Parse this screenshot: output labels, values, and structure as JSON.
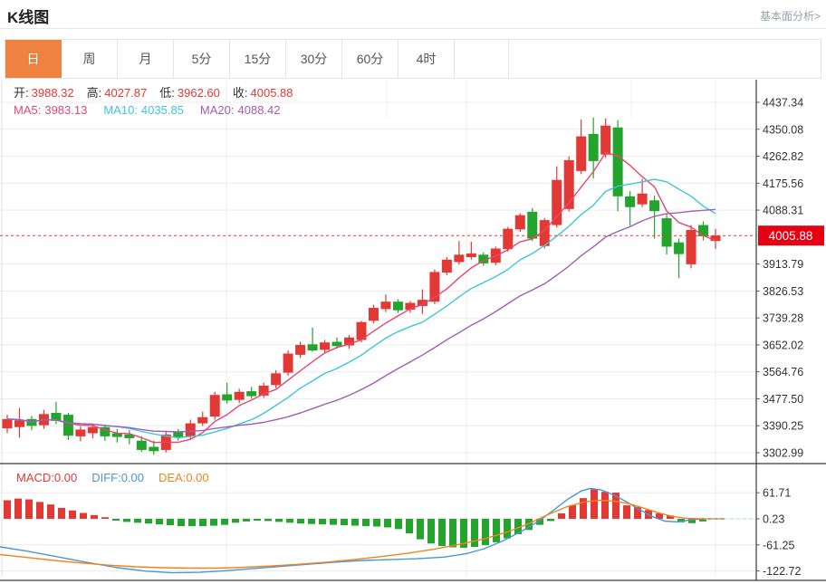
{
  "header": {
    "title": "K线图",
    "link": "基本面分析>"
  },
  "tabs": [
    {
      "label": "日",
      "active": true
    },
    {
      "label": "周",
      "active": false
    },
    {
      "label": "月",
      "active": false
    },
    {
      "label": "5分",
      "active": false
    },
    {
      "label": "15分",
      "active": false
    },
    {
      "label": "30分",
      "active": false
    },
    {
      "label": "60分",
      "active": false
    },
    {
      "label": "4时",
      "active": false
    }
  ],
  "info": {
    "open_label": "开:",
    "open": "3988.32",
    "high_label": "高:",
    "high": "4027.87",
    "low_label": "低:",
    "low": "3962.60",
    "close_label": "收:",
    "close": "4005.88",
    "ma5_label": "MA5:",
    "ma5": "3983.13",
    "ma10_label": "MA10:",
    "ma10": "4035.85",
    "ma20_label": "MA20:",
    "ma20": "4088.42"
  },
  "colors": {
    "up": "#e23934",
    "down": "#22a42d",
    "ma5": "#e8456f",
    "ma10": "#3ec6db",
    "ma20": "#a35cb5",
    "diff": "#4a97d2",
    "dea": "#f5821f",
    "tab_accent": "#ef8240",
    "price_box": "#e60012",
    "label": "#333333",
    "grid": "#ececec",
    "axis": "#3a3a3a"
  },
  "chart_data": {
    "type": "candlestick",
    "title": "K线图",
    "y_ticks": [
      "4437.34",
      "4350.08",
      "4262.82",
      "4175.56",
      "4088.31",
      "3913.79",
      "3826.53",
      "3739.28",
      "3652.02",
      "3564.76",
      "3477.50",
      "3390.25",
      "3302.99"
    ],
    "y_top_value": 4437.34,
    "y_bottom_value": 3302.99,
    "price_line": {
      "value": 4005.88,
      "label": "4005.88"
    },
    "ma_periods": [
      5,
      10,
      20
    ],
    "candles": [
      [
        3382,
        3426,
        3366,
        3412
      ],
      [
        3386,
        3448,
        3352,
        3408
      ],
      [
        3412,
        3422,
        3376,
        3390
      ],
      [
        3392,
        3442,
        3380,
        3428
      ],
      [
        3432,
        3468,
        3396,
        3406
      ],
      [
        3426,
        3432,
        3344,
        3358
      ],
      [
        3356,
        3388,
        3340,
        3378
      ],
      [
        3366,
        3396,
        3350,
        3386
      ],
      [
        3386,
        3394,
        3342,
        3356
      ],
      [
        3366,
        3380,
        3336,
        3354
      ],
      [
        3362,
        3376,
        3330,
        3350
      ],
      [
        3342,
        3356,
        3306,
        3312
      ],
      [
        3322,
        3342,
        3296,
        3308
      ],
      [
        3312,
        3374,
        3304,
        3362
      ],
      [
        3370,
        3380,
        3342,
        3352
      ],
      [
        3356,
        3410,
        3348,
        3398
      ],
      [
        3398,
        3436,
        3390,
        3418
      ],
      [
        3420,
        3500,
        3410,
        3490
      ],
      [
        3492,
        3530,
        3462,
        3472
      ],
      [
        3474,
        3510,
        3464,
        3500
      ],
      [
        3502,
        3516,
        3478,
        3486
      ],
      [
        3488,
        3530,
        3480,
        3520
      ],
      [
        3522,
        3570,
        3512,
        3560
      ],
      [
        3562,
        3634,
        3552,
        3624
      ],
      [
        3620,
        3662,
        3610,
        3652
      ],
      [
        3654,
        3708,
        3630,
        3634
      ],
      [
        3636,
        3668,
        3628,
        3660
      ],
      [
        3662,
        3676,
        3640,
        3648
      ],
      [
        3650,
        3684,
        3640,
        3676
      ],
      [
        3668,
        3730,
        3660,
        3726
      ],
      [
        3730,
        3782,
        3722,
        3772
      ],
      [
        3768,
        3815,
        3758,
        3792
      ],
      [
        3792,
        3800,
        3755,
        3764
      ],
      [
        3766,
        3794,
        3756,
        3788
      ],
      [
        3778,
        3832,
        3752,
        3798
      ],
      [
        3792,
        3896,
        3784,
        3888
      ],
      [
        3886,
        3936,
        3878,
        3928
      ],
      [
        3920,
        3988,
        3912,
        3944
      ],
      [
        3936,
        3986,
        3928,
        3948
      ],
      [
        3944,
        3952,
        3908,
        3916
      ],
      [
        3918,
        3970,
        3910,
        3964
      ],
      [
        3962,
        4034,
        3954,
        4028
      ],
      [
        4026,
        4078,
        4018,
        4072
      ],
      [
        4083,
        4095,
        3988,
        3996
      ],
      [
        3972,
        4062,
        3964,
        4056
      ],
      [
        4040,
        4230,
        4032,
        4186
      ],
      [
        4092,
        4262,
        4084,
        4250
      ],
      [
        4215,
        4382,
        4205,
        4327
      ],
      [
        4335,
        4388,
        4191,
        4247
      ],
      [
        4268,
        4385,
        4258,
        4362
      ],
      [
        4356,
        4380,
        4085,
        4133
      ],
      [
        4133,
        4150,
        4038,
        4098
      ],
      [
        4107,
        4189,
        4098,
        4142
      ],
      [
        4120,
        4135,
        3996,
        4085
      ],
      [
        4062,
        4075,
        3945,
        3970
      ],
      [
        3984,
        3996,
        3868,
        3946
      ],
      [
        3913,
        4040,
        3900,
        4024
      ],
      [
        4040,
        4052,
        3990,
        4004
      ],
      [
        3988.32,
        4027.87,
        3962.6,
        4005.88
      ]
    ],
    "macd": {
      "type": "bar",
      "labels": {
        "macd": "MACD:0.00",
        "diff": "DIFF:0.00",
        "dea": "DEA:0.00"
      },
      "y_ticks": [
        "61.71",
        "0.23",
        "-61.25",
        "-122.72"
      ],
      "zero": 0.23,
      "bars": [
        44,
        48,
        46,
        40,
        34,
        26,
        20,
        14,
        9,
        4,
        -4,
        -7,
        -9,
        -11,
        -13,
        -15,
        -17,
        -17,
        -17,
        -16,
        -14,
        -9,
        -6,
        -4,
        -5,
        -7,
        -9,
        -11,
        -12,
        -13,
        -14,
        -15,
        -16,
        -17,
        -18,
        -20,
        -24,
        -34,
        -48,
        -58,
        -64,
        -67,
        -68,
        -66,
        -62,
        -55,
        -46,
        -36,
        -26,
        -14,
        -5,
        13,
        32,
        49,
        70,
        64,
        62,
        32,
        28,
        21,
        13,
        8,
        -8,
        -10,
        -6
      ],
      "diff": [
        [
          0,
          -66
        ],
        [
          30,
          -76
        ],
        [
          60,
          -88
        ],
        [
          95,
          -102
        ],
        [
          130,
          -115
        ],
        [
          160,
          -123
        ],
        [
          190,
          -127
        ],
        [
          220,
          -126
        ],
        [
          250,
          -122
        ],
        [
          280,
          -117
        ],
        [
          310,
          -112
        ],
        [
          340,
          -107
        ],
        [
          370,
          -102
        ],
        [
          400,
          -98
        ],
        [
          430,
          -96
        ],
        [
          460,
          -94
        ],
        [
          490,
          -90
        ],
        [
          515,
          -82
        ],
        [
          535,
          -70
        ],
        [
          555,
          -52
        ],
        [
          575,
          -30
        ],
        [
          595,
          -5
        ],
        [
          612,
          22
        ],
        [
          628,
          48
        ],
        [
          642,
          66
        ],
        [
          652,
          72
        ],
        [
          664,
          68
        ],
        [
          678,
          56
        ],
        [
          692,
          40
        ],
        [
          706,
          22
        ],
        [
          720,
          6
        ],
        [
          734,
          -5
        ],
        [
          748,
          -7
        ],
        [
          760,
          -3
        ],
        [
          775,
          0.2
        ],
        [
          800,
          0.2
        ]
      ],
      "dea": [
        [
          0,
          -84
        ],
        [
          30,
          -91
        ],
        [
          60,
          -98
        ],
        [
          90,
          -104
        ],
        [
          120,
          -109
        ],
        [
          150,
          -113
        ],
        [
          180,
          -115
        ],
        [
          210,
          -116
        ],
        [
          240,
          -116
        ],
        [
          270,
          -114
        ],
        [
          300,
          -111
        ],
        [
          330,
          -107
        ],
        [
          360,
          -102
        ],
        [
          390,
          -96
        ],
        [
          420,
          -89
        ],
        [
          450,
          -81
        ],
        [
          480,
          -71
        ],
        [
          510,
          -59
        ],
        [
          535,
          -47
        ],
        [
          560,
          -31
        ],
        [
          585,
          -10
        ],
        [
          605,
          10
        ],
        [
          625,
          28
        ],
        [
          645,
          40
        ],
        [
          662,
          44
        ],
        [
          678,
          42
        ],
        [
          694,
          36
        ],
        [
          710,
          26
        ],
        [
          726,
          15
        ],
        [
          742,
          6
        ],
        [
          758,
          1.5
        ],
        [
          775,
          0.3
        ],
        [
          800,
          0.2
        ]
      ]
    }
  }
}
